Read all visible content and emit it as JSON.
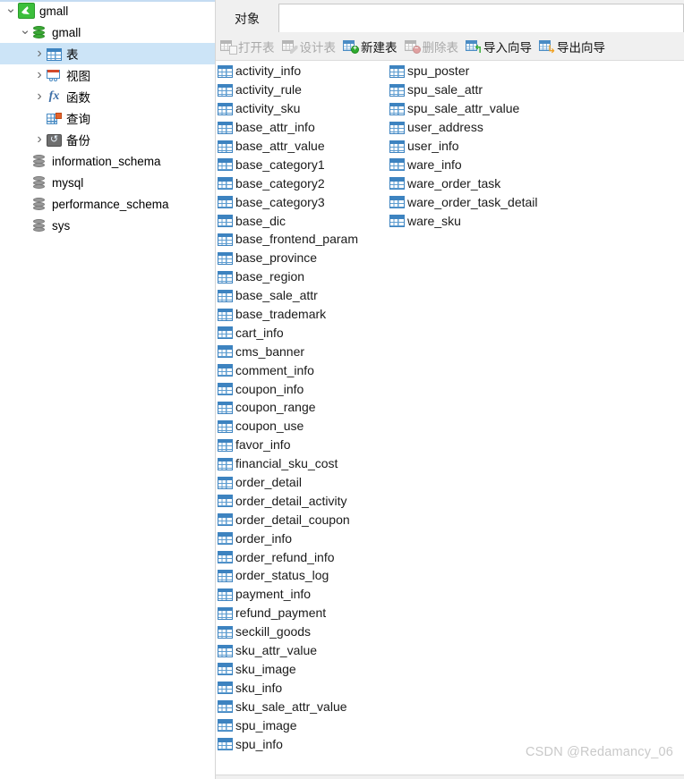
{
  "sidebar": {
    "nodes": [
      {
        "label": "gmall",
        "icon": "mysql-connection-icon",
        "indent": 0,
        "chevron": "down",
        "selected": false
      },
      {
        "label": "gmall",
        "icon": "database-green-icon",
        "indent": 1,
        "chevron": "down",
        "selected": false
      },
      {
        "label": "表",
        "icon": "table-grid-icon",
        "indent": 2,
        "chevron": "right",
        "selected": true
      },
      {
        "label": "视图",
        "icon": "view-icon",
        "indent": 2,
        "chevron": "right",
        "selected": false
      },
      {
        "label": "函数",
        "icon": "function-fx-icon",
        "indent": 2,
        "chevron": "right",
        "selected": false
      },
      {
        "label": "查询",
        "icon": "query-icon",
        "indent": 2,
        "chevron": "none",
        "selected": false
      },
      {
        "label": "备份",
        "icon": "backup-icon",
        "indent": 2,
        "chevron": "right",
        "selected": false
      },
      {
        "label": "information_schema",
        "icon": "database-gray-icon",
        "indent": 1,
        "chevron": "none",
        "selected": false
      },
      {
        "label": "mysql",
        "icon": "database-gray-icon",
        "indent": 1,
        "chevron": "none",
        "selected": false
      },
      {
        "label": "performance_schema",
        "icon": "database-gray-icon",
        "indent": 1,
        "chevron": "none",
        "selected": false
      },
      {
        "label": "sys",
        "icon": "database-gray-icon",
        "indent": 1,
        "chevron": "none",
        "selected": false
      }
    ]
  },
  "tabs": {
    "active": "对象",
    "items": [
      "对象"
    ]
  },
  "toolbar": {
    "buttons": [
      {
        "label": "打开表",
        "icon": "open-table-icon",
        "enabled": false
      },
      {
        "label": "设计表",
        "icon": "design-table-icon",
        "enabled": false
      },
      {
        "label": "新建表",
        "icon": "new-table-icon",
        "enabled": true
      },
      {
        "label": "删除表",
        "icon": "delete-table-icon",
        "enabled": false
      },
      {
        "label": "导入向导",
        "icon": "import-wizard-icon",
        "enabled": true
      },
      {
        "label": "导出向导",
        "icon": "export-wizard-icon",
        "enabled": true
      }
    ]
  },
  "table_list": {
    "column_1": [
      "activity_info",
      "activity_rule",
      "activity_sku",
      "base_attr_info",
      "base_attr_value",
      "base_category1",
      "base_category2",
      "base_category3",
      "base_dic",
      "base_frontend_param",
      "base_province",
      "base_region",
      "base_sale_attr",
      "base_trademark",
      "cart_info",
      "cms_banner",
      "comment_info",
      "coupon_info",
      "coupon_range",
      "coupon_use",
      "favor_info",
      "financial_sku_cost",
      "order_detail",
      "order_detail_activity",
      "order_detail_coupon",
      "order_info",
      "order_refund_info",
      "order_status_log",
      "payment_info",
      "refund_payment",
      "seckill_goods",
      "sku_attr_value",
      "sku_image",
      "sku_info",
      "sku_sale_attr_value",
      "spu_image",
      "spu_info"
    ],
    "column_2": [
      "spu_poster",
      "spu_sale_attr",
      "spu_sale_attr_value",
      "user_address",
      "user_info",
      "ware_info",
      "ware_order_task",
      "ware_order_task_detail",
      "ware_sku"
    ]
  },
  "watermark": "CSDN @Redamancy_06",
  "colors": {
    "selection": "#cce4f7",
    "table_icon": "#3d83c0",
    "chrome": "#f0f0f0",
    "watermark": "#c9c9c9"
  }
}
